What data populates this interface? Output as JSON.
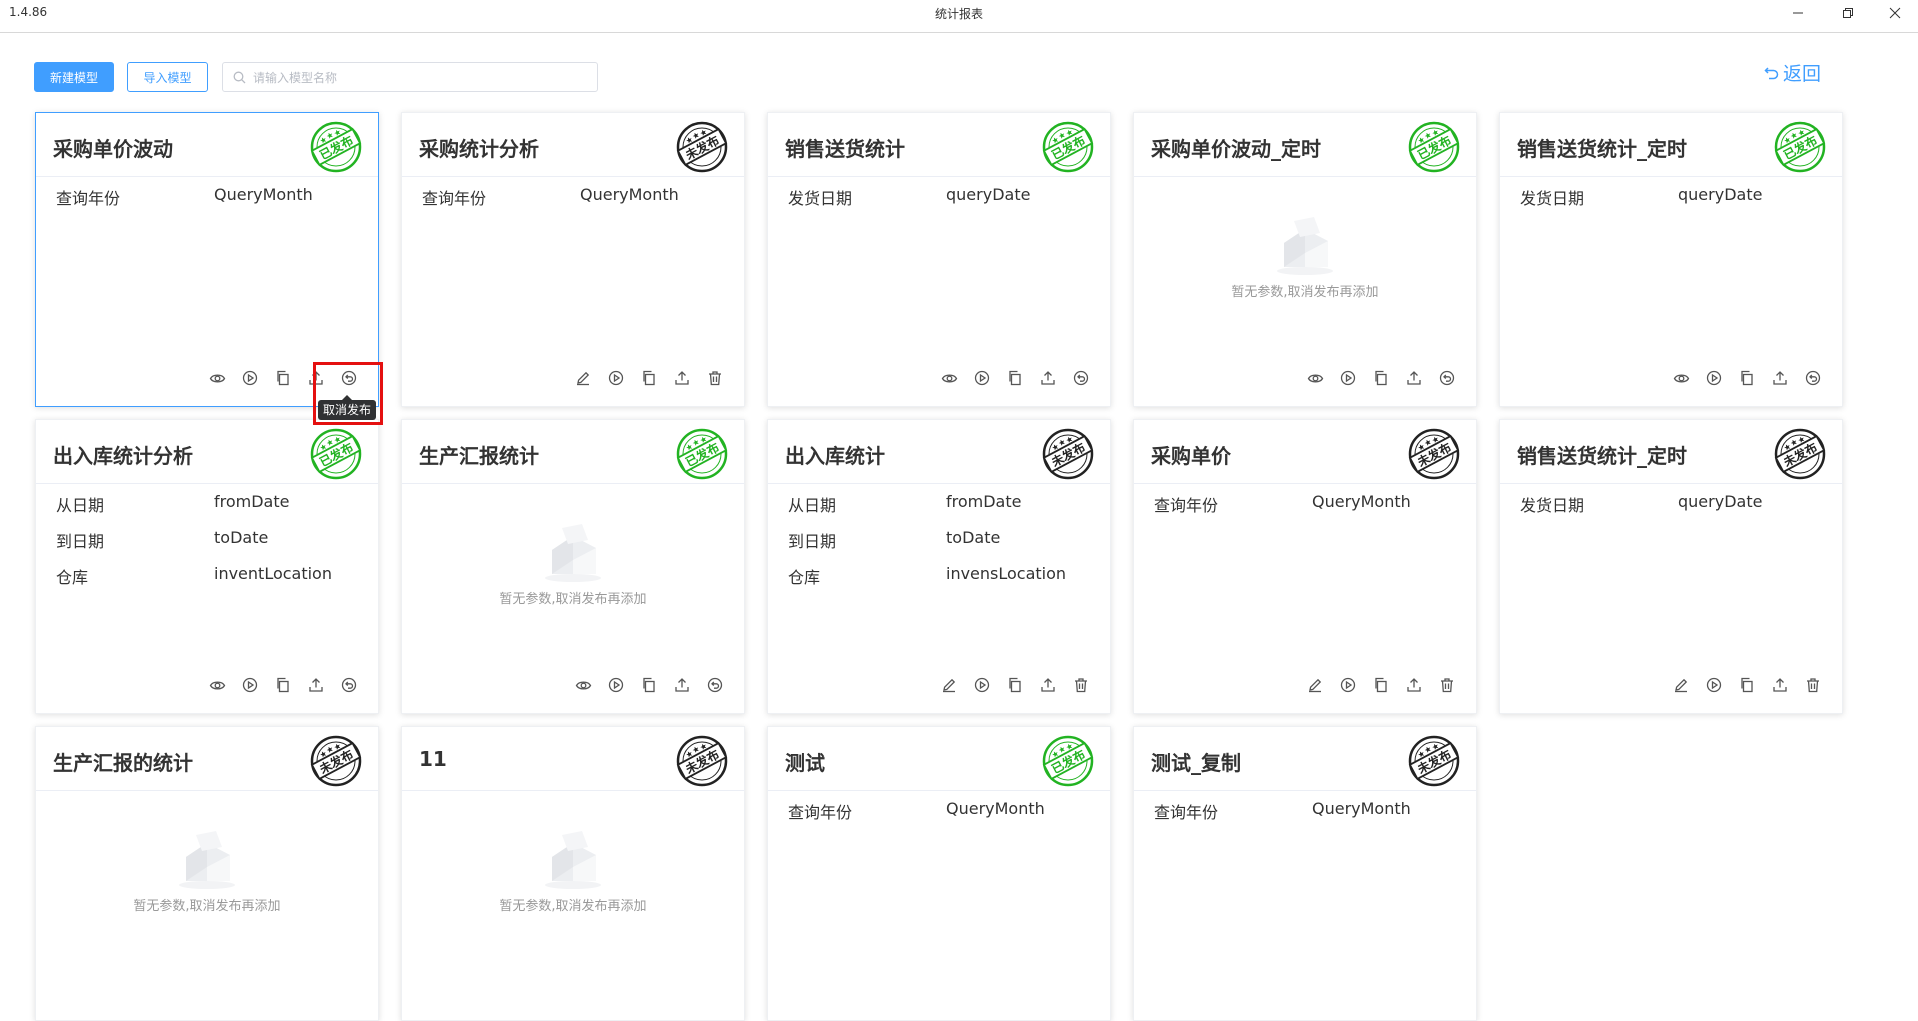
{
  "window": {
    "version": "1.4.86",
    "title": "统计报表"
  },
  "toolbar": {
    "new_model": "新建模型",
    "import_model": "导入模型",
    "search_placeholder": "请输入模型名称",
    "back": "返回"
  },
  "stamps": {
    "published": "已发布",
    "unpublished": "未发布"
  },
  "empty_text": "暂无参数,取消发布再添加",
  "tooltip": "取消发布",
  "colors": {
    "primary": "#409eff",
    "published": "#22b322",
    "unpublished": "#222222",
    "highlight": "#e41010"
  },
  "cards": [
    {
      "title": "采购单价波动",
      "status": "published",
      "params": [
        {
          "name": "查询年份",
          "value": "QueryMonth"
        }
      ]
    },
    {
      "title": "采购统计分析",
      "status": "unpublished",
      "params": [
        {
          "name": "查询年份",
          "value": "QueryMonth"
        }
      ]
    },
    {
      "title": "销售送货统计",
      "status": "published",
      "params": [
        {
          "name": "发货日期",
          "value": "queryDate"
        }
      ]
    },
    {
      "title": "采购单价波动_定时",
      "status": "published",
      "params": []
    },
    {
      "title": "销售送货统计_定时",
      "status": "published",
      "params": [
        {
          "name": "发货日期",
          "value": "queryDate"
        }
      ]
    },
    {
      "title": "出入库统计分析",
      "status": "published",
      "params": [
        {
          "name": "从日期",
          "value": "fromDate"
        },
        {
          "name": "到日期",
          "value": "toDate"
        },
        {
          "name": "仓库",
          "value": "inventLocation"
        }
      ]
    },
    {
      "title": "生产汇报统计",
      "status": "published",
      "params": []
    },
    {
      "title": "出入库统计",
      "status": "unpublished",
      "params": [
        {
          "name": "从日期",
          "value": "fromDate"
        },
        {
          "name": "到日期",
          "value": "toDate"
        },
        {
          "name": "仓库",
          "value": "invensLocation"
        }
      ]
    },
    {
      "title": "采购单价",
      "status": "unpublished",
      "params": [
        {
          "name": "查询年份",
          "value": "QueryMonth"
        }
      ]
    },
    {
      "title": "销售送货统计_定时",
      "status": "unpublished",
      "params": [
        {
          "name": "发货日期",
          "value": "queryDate"
        }
      ]
    },
    {
      "title": "生产汇报的统计",
      "status": "unpublished",
      "params": []
    },
    {
      "title": "11",
      "status": "unpublished",
      "params": []
    },
    {
      "title": "测试",
      "status": "published",
      "params": [
        {
          "name": "查询年份",
          "value": "QueryMonth"
        }
      ]
    },
    {
      "title": "测试_复制",
      "status": "unpublished",
      "params": [
        {
          "name": "查询年份",
          "value": "QueryMonth"
        }
      ]
    }
  ],
  "icons": {
    "published_actions": [
      "eye-icon",
      "play-icon",
      "copy-icon",
      "upload-icon",
      "unpublish-icon"
    ],
    "unpublished_actions": [
      "edit-icon",
      "play-icon",
      "copy-icon",
      "upload-icon",
      "delete-icon"
    ]
  }
}
